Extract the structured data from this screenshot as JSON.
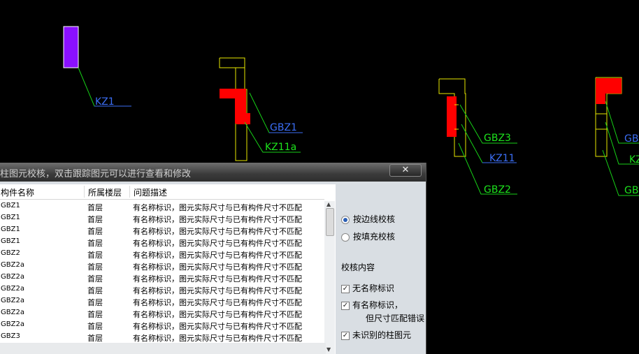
{
  "cad": {
    "labels": [
      "KZ1",
      "GBZ1",
      "KZ11a",
      "GBZ3",
      "KZ11",
      "GBZ2",
      "GBZ",
      "KZ",
      "GB"
    ],
    "colors": {
      "label_green": "#1de31d",
      "label_blue": "#3b6ef5",
      "outline_yellow": "#e8e800",
      "fill_red": "#ff0000",
      "fill_purple": "#8a10ff",
      "leader_green": "#17d117"
    }
  },
  "dialog": {
    "title": "柱图元校核，双击跟踪图元可以进行查看和修改",
    "close_label": "✕",
    "columns": [
      "构件名称",
      "所属楼层",
      "问题描述"
    ],
    "rows": [
      {
        "name": "GBZ1",
        "floor": "首层",
        "desc": "有名称标识，图元实际尺寸与已有构件尺寸不匹配"
      },
      {
        "name": "GBZ1",
        "floor": "首层",
        "desc": "有名称标识，图元实际尺寸与已有构件尺寸不匹配"
      },
      {
        "name": "GBZ1",
        "floor": "首层",
        "desc": "有名称标识，图元实际尺寸与已有构件尺寸不匹配"
      },
      {
        "name": "GBZ1",
        "floor": "首层",
        "desc": "有名称标识，图元实际尺寸与已有构件尺寸不匹配"
      },
      {
        "name": "GBZ2",
        "floor": "首层",
        "desc": "有名称标识，图元实际尺寸与已有构件尺寸不匹配"
      },
      {
        "name": "GBZ2a",
        "floor": "首层",
        "desc": "有名称标识，图元实际尺寸与已有构件尺寸不匹配"
      },
      {
        "name": "GBZ2a",
        "floor": "首层",
        "desc": "有名称标识，图元实际尺寸与已有构件尺寸不匹配"
      },
      {
        "name": "GBZ2a",
        "floor": "首层",
        "desc": "有名称标识，图元实际尺寸与已有构件尺寸不匹配"
      },
      {
        "name": "GBZ2a",
        "floor": "首层",
        "desc": "有名称标识，图元实际尺寸与已有构件尺寸不匹配"
      },
      {
        "name": "GBZ2a",
        "floor": "首层",
        "desc": "有名称标识，图元实际尺寸与已有构件尺寸不匹配"
      },
      {
        "name": "GBZ2a",
        "floor": "首层",
        "desc": "有名称标识，图元实际尺寸与已有构件尺寸不匹配"
      },
      {
        "name": "GBZ3",
        "floor": "首层",
        "desc": "有名称标识，图元实际尺寸与已有构件尺寸不匹配"
      }
    ],
    "options": {
      "radio_edge": "按边线校核",
      "radio_fill": "按填充校核",
      "section_title": "校核内容",
      "check_no_name": "无名称标识",
      "check_has_name_line1": "有名称标识，",
      "check_has_name_line2": "但尺寸匹配错误",
      "check_unrecognized": "未识别的柱图元"
    }
  }
}
